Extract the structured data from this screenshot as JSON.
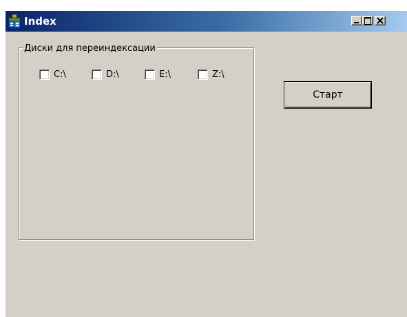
{
  "window": {
    "title": "Index",
    "app_icon": "database-icon",
    "controls": {
      "minimize_icon": "minimize-icon",
      "maximize_icon": "maximize-icon",
      "close_icon": "close-icon"
    }
  },
  "groupbox": {
    "label": "Диски для переиндексации",
    "drives": [
      {
        "label": "C:\\",
        "checked": false
      },
      {
        "label": "D:\\",
        "checked": false
      },
      {
        "label": "E:\\",
        "checked": false
      },
      {
        "label": "Z:\\",
        "checked": false
      }
    ]
  },
  "start_button": {
    "label": "Старт"
  },
  "colors": {
    "window_bg": "#d4d0c8",
    "titlebar_start": "#0a246a",
    "titlebar_end": "#a6caf0",
    "title_text": "#ffffff"
  }
}
